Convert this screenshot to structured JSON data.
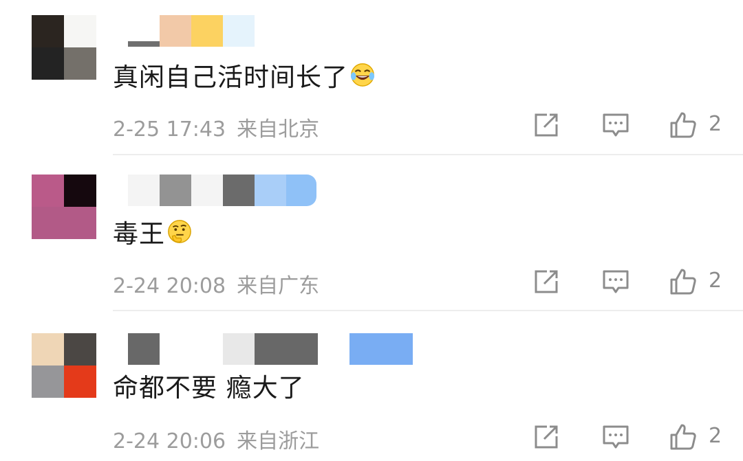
{
  "comments": [
    {
      "text": "真闲自己活时间长了",
      "emoji": "laughing-tears-emoji",
      "time": "2-25 17:43",
      "location": "来自北京",
      "likes": "2",
      "avatar_colors": [
        "#2b2520",
        "#f6f6f4",
        "#232323",
        "#74706a"
      ],
      "name_colors": [
        "#f2c9a8",
        "#fcd261",
        "#e5f3fc"
      ]
    },
    {
      "text": "毒王",
      "emoji": "thinking-emoji",
      "time": "2-24 20:08",
      "location": "来自广东",
      "likes": "2",
      "avatar_colors": [
        "#ba5a89",
        "#15080e",
        "#b25a87",
        "#b25a87"
      ],
      "name_colors": [
        "#f4f4f4",
        "#939393",
        "#f4f4f4",
        "#6b6b6b",
        "#a9cef8",
        "#8fc1f7"
      ]
    },
    {
      "text": "命都不要 瘾大了",
      "emoji": "",
      "time": "2-24 20:06",
      "location": "来自浙江",
      "likes": "2",
      "avatar_colors": [
        "#efd6b6",
        "#4b4744",
        "#969699",
        "#e43a1a"
      ],
      "name_colors": [
        "#686868",
        "#ffffff",
        "#e8e8e8",
        "#686868",
        "#ffffff",
        "#79adf3"
      ]
    }
  ],
  "icons": {
    "share": "share-icon",
    "reply": "comment-icon",
    "like": "thumbs-up-icon"
  }
}
